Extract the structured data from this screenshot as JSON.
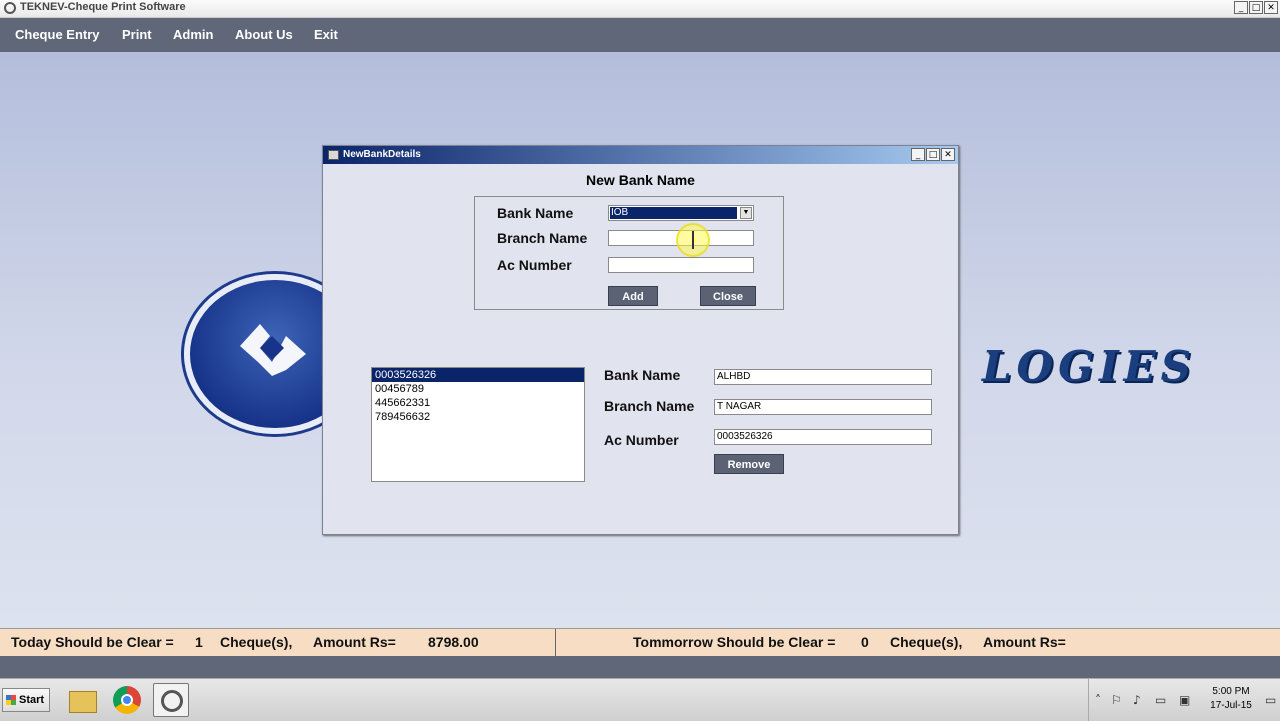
{
  "window": {
    "title": "TEKNEV-Cheque Print Software",
    "controls": [
      "_",
      "□",
      "✕"
    ]
  },
  "menu": [
    "Cheque Entry",
    "Print",
    "Admin",
    "About Us",
    "Exit"
  ],
  "background": {
    "logo_text": "LOGIES"
  },
  "dialog": {
    "title": "NewBankDetails",
    "controls": [
      "_",
      "□",
      "✕"
    ],
    "heading": "New Bank Name",
    "form": {
      "bank_label": "Bank Name",
      "bank_value": "IOB",
      "branch_label": "Branch Name",
      "branch_value": "",
      "ac_label": "Ac Number",
      "ac_value": "",
      "add_button": "Add",
      "close_button": "Close"
    },
    "accounts": [
      "0003526326",
      "00456789",
      "445662331",
      "789456632"
    ],
    "selected_account_index": 0,
    "details": {
      "bank_label": "Bank Name",
      "bank_value": "ALHBD",
      "branch_label": "Branch Name",
      "branch_value": "T NAGAR",
      "ac_label": "Ac Number",
      "ac_value": "0003526326",
      "remove_button": "Remove"
    }
  },
  "status": {
    "today_label": "Today Should be Clear =",
    "today_count": "1",
    "today_cheques": "Cheque(s),",
    "today_amount_label": "Amount  Rs=",
    "today_amount": "8798.00",
    "tomorrow_label": "Tommorrow Should be Clear =",
    "tomorrow_count": "0",
    "tomorrow_cheques": "Cheque(s),",
    "tomorrow_amount_label": "Amount  Rs="
  },
  "taskbar": {
    "start": "Start",
    "apps": [
      "file-explorer-icon",
      "chrome-icon",
      "teknev-app-icon"
    ],
    "time": "5:00 PM",
    "date": "17-Jul-15"
  },
  "colors": {
    "menubar": "#5f6778",
    "dialog_title": "#0a246a",
    "status_bg": "#f6ddc4"
  }
}
